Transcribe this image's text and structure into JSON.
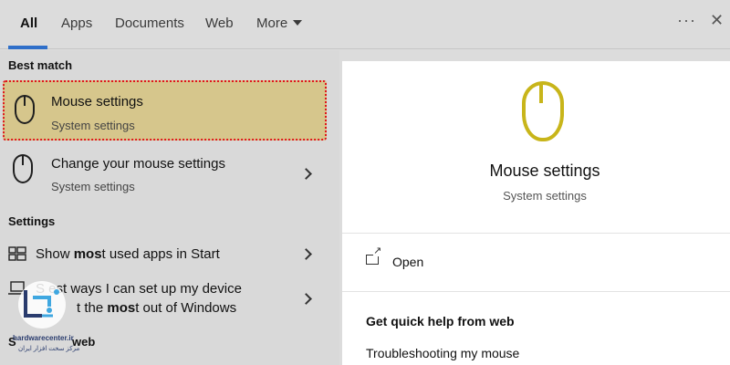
{
  "tabs": [
    {
      "label": "All",
      "active": true
    },
    {
      "label": "Apps"
    },
    {
      "label": "Documents"
    },
    {
      "label": "Web"
    },
    {
      "label": "More"
    }
  ],
  "topbar": {
    "more_icon": "ellipsis-icon",
    "close_icon": "close-icon"
  },
  "left": {
    "best_match_header": "Best match",
    "settings_header": "Settings",
    "web_header_partial": "S",
    "web_header_partial_end": "web",
    "best_match": {
      "title": "Mouse settings",
      "subtitle": "System settings",
      "icon": "mouse-icon"
    },
    "change_mouse": {
      "title": "Change your mouse settings",
      "subtitle": "System settings",
      "icon": "mouse-icon"
    },
    "settings_items": [
      {
        "prefix": "Show ",
        "bold": "mos",
        "suffix": "t used apps in Start",
        "icon": "start-tiles-icon"
      },
      {
        "line1": "S  est ways I can set up my device",
        "line2_prefix": "t the ",
        "line2_bold": "mos",
        "line2_suffix": "t out of Windows",
        "icon": "laptop-icon"
      }
    ]
  },
  "detail": {
    "title": "Mouse settings",
    "subtitle": "System settings",
    "icon": "mouse-icon",
    "icon_color": "#c8b51a",
    "open_label": "Open",
    "web_header": "Get quick help from web",
    "web_link": "Troubleshooting my mouse"
  },
  "watermark": {
    "brand": "hardwarecenter.ir",
    "tagline": "مرکز سخت افزار ایران"
  },
  "colors": {
    "accent": "#2f6fc9",
    "selection": "#d6c68c",
    "selection_border": "#e0151b"
  }
}
